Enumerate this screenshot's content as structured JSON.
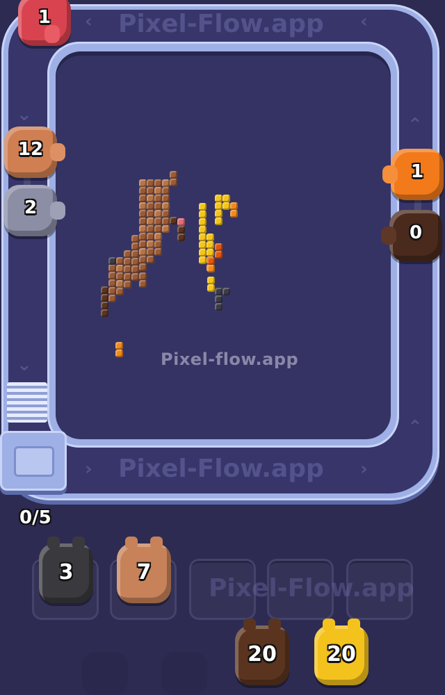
{
  "watermark": "Pixel-flow.app",
  "lane_watermark_top": "Pixel-Flow.app",
  "lane_watermark_bottom": "Pixel-Flow.app",
  "lane_watermark_faint": "Pixel-Flow.app",
  "queue_counter": "0/5",
  "conveyor_pigs": [
    {
      "count": "1",
      "color": "#d9434f",
      "position": "top-left corner"
    },
    {
      "count": "12",
      "color": "#cf7f52",
      "position": "left lane"
    },
    {
      "count": "2",
      "color": "#8b8ea5",
      "position": "left lane"
    },
    {
      "count": "1",
      "color": "#f27a1a",
      "position": "right lane"
    },
    {
      "count": "0",
      "color": "#4a2a1c",
      "position": "right lane"
    }
  ],
  "holding_slots": [
    {
      "count": "3",
      "color": "#3a3a3e"
    },
    {
      "count": "7",
      "color": "#c7825a"
    },
    {
      "count": "",
      "color": ""
    },
    {
      "count": "",
      "color": ""
    },
    {
      "count": "",
      "color": ""
    }
  ],
  "waiting_pigs": [
    {
      "count": "20",
      "color": "#5b341f"
    },
    {
      "count": "20",
      "color": "#f4c21c"
    }
  ],
  "pixel_colors": {
    "brown": "#9a5a35",
    "light_brown": "#b77447",
    "dark_brown": "#5a3420",
    "yellow": "#f5c518",
    "orange": "#f08a1a",
    "dark_orange": "#e0580e",
    "gray": "#3c3c48",
    "pink": "#e06a78"
  }
}
